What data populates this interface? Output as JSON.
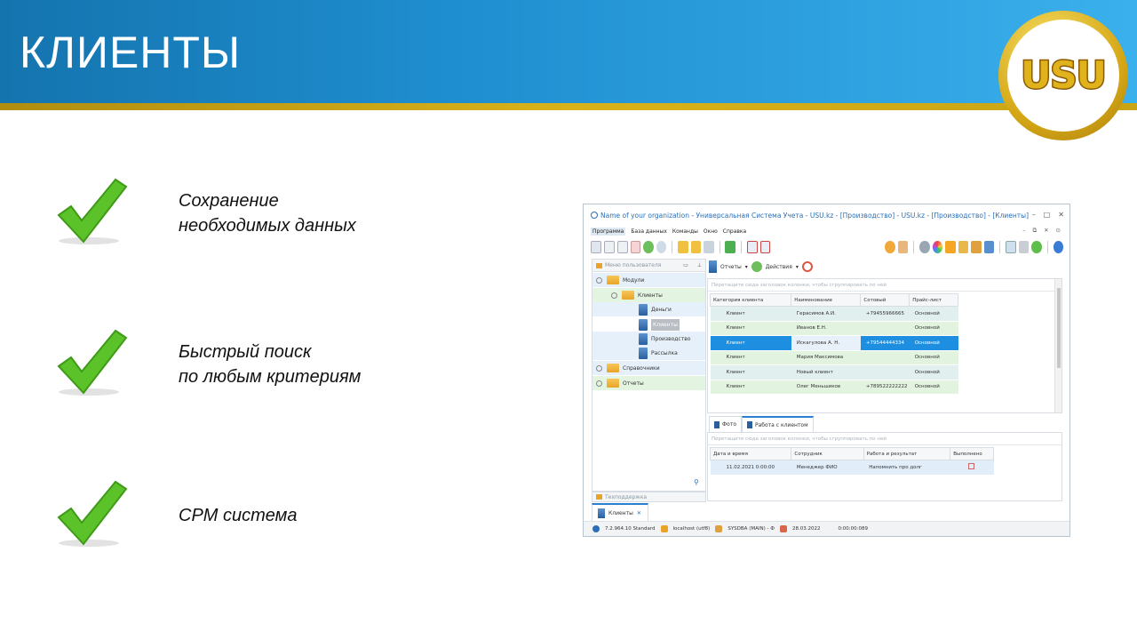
{
  "slide": {
    "title": "КЛИЕНТЫ",
    "logo_text": "USU",
    "features": [
      {
        "line1": "Сохранение",
        "line2": "необходимых данных"
      },
      {
        "line1": "Быстрый поиск",
        "line2": "по любым критериям"
      },
      {
        "line1": "CPM система",
        "line2": ""
      }
    ],
    "colors": {
      "banner": "#1f8ed0",
      "stripe": "#d9b21a",
      "check": "#5cc22a"
    }
  },
  "window": {
    "title": "Name of your organization - Универсальная Система Учета - USU.kz - [Производство] - USU.kz - [Производство] - [Клиенты]",
    "menu": [
      "Программа",
      "База данных",
      "Команды",
      "Окно",
      "Справка"
    ],
    "left_panel_title": "Меню пользователя",
    "tree": {
      "modules": "Модули",
      "clients": "Клиенты",
      "money": "Деньги",
      "clients_sub": "Клиенты",
      "production": "Производство",
      "mailing": "Рассылка",
      "reference": "Справочники",
      "reports": "Отчеты"
    },
    "support_panel_title": "Техподдержка",
    "reports_btn": "Отчеты",
    "actions_btn": "Действия",
    "group_hint": "Перетащите сюда заголовок колонки, чтобы сгруппировать по ней",
    "columns": [
      "Категория клиента",
      "Наименование",
      "Сотовый",
      "Прайс-лист"
    ],
    "rows": [
      {
        "category": "Клиент",
        "name": "Герасимов А.И.",
        "phone": "+79455966665",
        "price": "Основной"
      },
      {
        "category": "Клиент",
        "name": "Иванов Е.Н.",
        "phone": "",
        "price": "Основной"
      },
      {
        "category": "Клиент",
        "name": "Искагулова А. Н.",
        "phone": "+79544444334",
        "price": "Основной"
      },
      {
        "category": "Клиент",
        "name": "Мария Максимова",
        "phone": "",
        "price": "Основной"
      },
      {
        "category": "Клиент",
        "name": "Новый клиент",
        "phone": "",
        "price": "Основной"
      },
      {
        "category": "Клиент",
        "name": "Олег Меньшиков",
        "phone": "+789522222222",
        "price": "Основной"
      }
    ],
    "bottom_tabs": [
      "Фото",
      "Работа с клиентом"
    ],
    "bottom_columns": [
      "Дата и время",
      "Сотрудник",
      "Работа и результат",
      "Выполнено"
    ],
    "bottom_rows": [
      {
        "date": "11.02.2021 0:00:00",
        "employee": "Менеджер ФИО",
        "result": "Напомнить про долг"
      }
    ],
    "doc_tab": "Клиенты",
    "status": {
      "version": "7.2.964.10 Standard",
      "db": "localhost (utf8)",
      "user": "SYSDBA (MAIN) - Ф",
      "date": "28.03.2022",
      "timer": "0:00:00:089"
    }
  }
}
